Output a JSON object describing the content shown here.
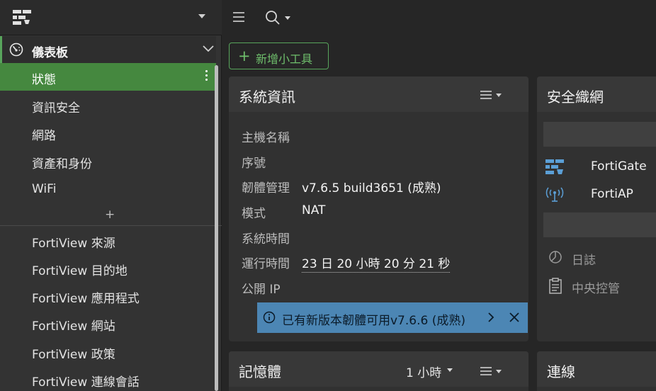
{
  "sidebar": {
    "dashboard_label": "儀表板",
    "items": [
      {
        "label": "狀態",
        "active": true
      },
      {
        "label": "資訊安全"
      },
      {
        "label": "網路"
      },
      {
        "label": "資產和身份"
      },
      {
        "label": "WiFi"
      }
    ],
    "add_label": "+",
    "views": [
      {
        "label": "FortiView 來源"
      },
      {
        "label": "FortiView 目的地"
      },
      {
        "label": "FortiView 應用程式"
      },
      {
        "label": "FortiView 網站"
      },
      {
        "label": "FortiView 政策"
      },
      {
        "label": "FortiView 連線會話"
      }
    ]
  },
  "toolbar": {
    "add_widget_icon": "+",
    "add_widget_label": "新增小工具"
  },
  "system_info": {
    "title": "系統資訊",
    "rows": [
      {
        "key": "主機名稱",
        "value": ""
      },
      {
        "key": "序號",
        "value": ""
      },
      {
        "key": "韌體管理",
        "value": "v7.6.5 build3651 (成熟)"
      },
      {
        "key": "模式",
        "value": "NAT"
      },
      {
        "key": "系統時間",
        "value": ""
      },
      {
        "key": "運行時間",
        "value": "23 日 20 小時 20 分 21 秒"
      },
      {
        "key": "公開 IP",
        "value": ""
      }
    ],
    "notification": "已有新版本韌體可用v7.6.6 (成熟)"
  },
  "security_fabric": {
    "title": "安全織網",
    "devices": [
      {
        "label": "FortiGate",
        "icon": "fortigate-icon"
      },
      {
        "label": "FortiAP",
        "icon": "wifi-ap-icon"
      }
    ],
    "services": [
      {
        "label": "日誌",
        "icon": "pie-chart-icon"
      },
      {
        "label": "中央控管",
        "icon": "clipboard-icon"
      }
    ]
  },
  "memory": {
    "title": "記憶體",
    "range": "1 小時"
  },
  "connections": {
    "title": "連線"
  },
  "colors": {
    "accent_green": "#45883f",
    "notification_blue": "#4c86b4"
  }
}
